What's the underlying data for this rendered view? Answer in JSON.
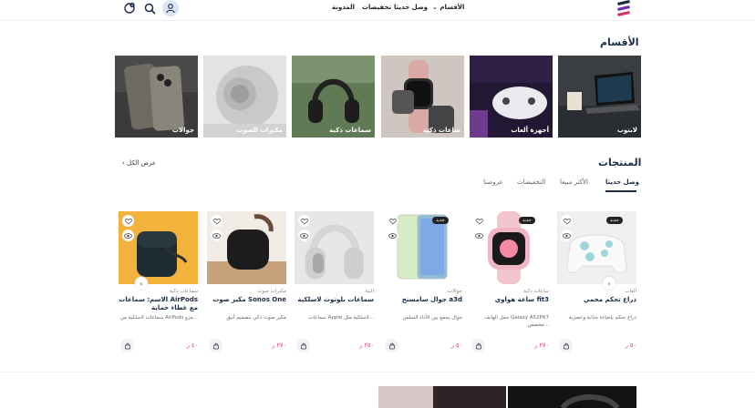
{
  "header": {
    "nav": [
      "الأقسام",
      "وصل حديثا",
      "تخفيضات",
      "المدونة"
    ],
    "cart_count": "0"
  },
  "categories_section": {
    "title": "الأقسام",
    "items": [
      {
        "label": "لابتوب"
      },
      {
        "label": "أجهزة ألعاب"
      },
      {
        "label": "ساعات ذكية"
      },
      {
        "label": "سماعات ذكية"
      },
      {
        "label": "مكبرات الصوت"
      },
      {
        "label": "جوالات"
      }
    ]
  },
  "products_section": {
    "title": "المنتجات",
    "see_all": "عرض الكل",
    "tabs": [
      "وصل حديثا",
      "الأكثر مبيعا",
      "التخفيضات",
      "عروضنا"
    ],
    "products": [
      {
        "category": "ألعاب",
        "name": "ذراع تحكم محمي",
        "desc": "ذراع تحكم بإضاءة جذابة وعصرية",
        "price": "٥٠ ر",
        "badge": "جديد"
      },
      {
        "category": "ساعات ذكية",
        "name": "ساعة هواوي fit3",
        "desc": "حمل الهاتف Galaxy A52P67 مخصص...",
        "price": "٢٧٠ ر",
        "badge": "جديد"
      },
      {
        "category": "جوالات",
        "name": "جوال سامسنج a3d",
        "desc": "جوال يجمع بين الأداء السلس",
        "price": "٥٠ ر",
        "badge": "جديد"
      },
      {
        "category": "النية",
        "name": "سماعات بلوتوث لاسلكية",
        "desc": "سماعات Apple لاسلكية مثل...",
        "price": "٢٥٠ ر",
        "badge": ""
      },
      {
        "category": "مكبرات صوت",
        "name": "مكبر صوت Sonos One",
        "desc": "مكبر صوت ذكي بتصميم أنيق",
        "price": "٢٧٠ ر",
        "badge": ""
      },
      {
        "category": "سماعات ذكية",
        "name": "الاسم: سماعات AirPods مع غطاء حماية",
        "desc": "سماعات لاسلكية من AirPods مزو...",
        "price": "٤٠ ر",
        "badge": ""
      }
    ]
  },
  "colors": {
    "navy": "#1a2b45",
    "price_pink": "#e0307a",
    "logo_purple": "#6b2fb3"
  }
}
